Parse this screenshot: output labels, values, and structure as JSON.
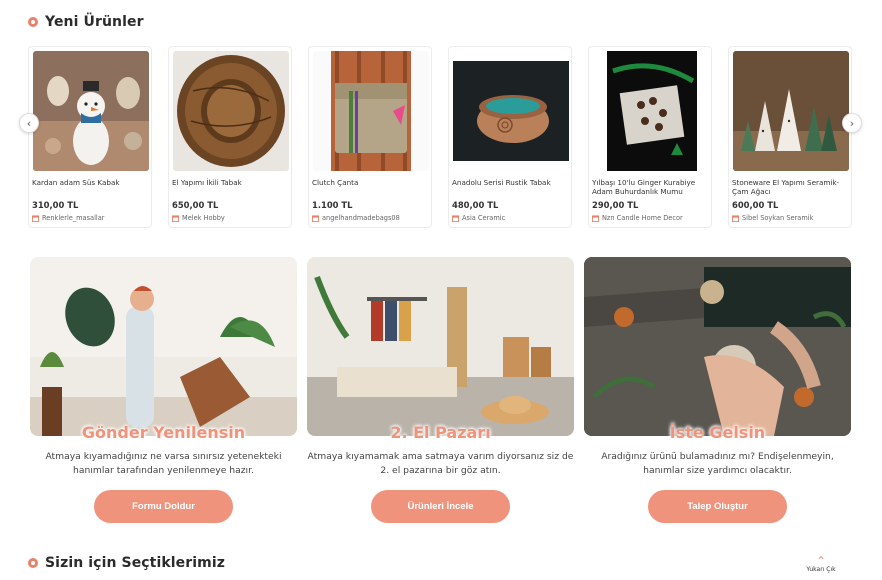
{
  "sections": {
    "new_products_title": "Yeni Ürünler",
    "picks_title": "Sizin için Seçtiklerimiz"
  },
  "products": [
    {
      "name": "Kardan adam Süs Kabak",
      "price": "310,00 TL",
      "seller": "Renklerle_masallar"
    },
    {
      "name": "El Yapımı İkili Tabak",
      "price": "650,00 TL",
      "seller": "Melek Hobby"
    },
    {
      "name": "Clutch Çanta",
      "price": "1.100 TL",
      "seller": "angelhandmadebags08"
    },
    {
      "name": "Anadolu Serisi Rustik Tabak",
      "price": "480,00 TL",
      "seller": "Asia Ceramic"
    },
    {
      "name": "Yılbaşı 10'lu Ginger Kurabiye Adam Buhurdanlık Mumu",
      "price": "290,00 TL",
      "seller": "Nzn Candle Home Decor"
    },
    {
      "name": "Stoneware El Yapımı Seramik-Çam Ağacı",
      "price": "600,00 TL",
      "seller": "Sibel Soykan Seramik"
    }
  ],
  "carousel": {
    "prev_icon": "chevron-left-icon",
    "next_icon": "chevron-right-icon"
  },
  "promos": [
    {
      "title": "Gönder  Yenilensin",
      "desc": "Atmaya kıyamadığınız ne varsa sınırsız yetenekteki hanımlar tarafından yenilenmeye hazır.",
      "button": "Formu Doldur"
    },
    {
      "title": "2. El Pazarı",
      "desc": "Atmaya kıyamamak ama satmaya varım diyorsanız siz de 2. el pazarına bir göz atın.",
      "button": "Ürünleri İncele"
    },
    {
      "title": "İste Gelsin",
      "desc": "Aradığınız ürünü bulamadınız mı? Endişelenmeyin, hanımlar size yardımcı olacaktır.",
      "button": "Talep Oluştur"
    }
  ],
  "to_top": {
    "label": "Yukarı Çık"
  },
  "colors": {
    "accent": "#f0937c",
    "dot": "#e8806a"
  }
}
